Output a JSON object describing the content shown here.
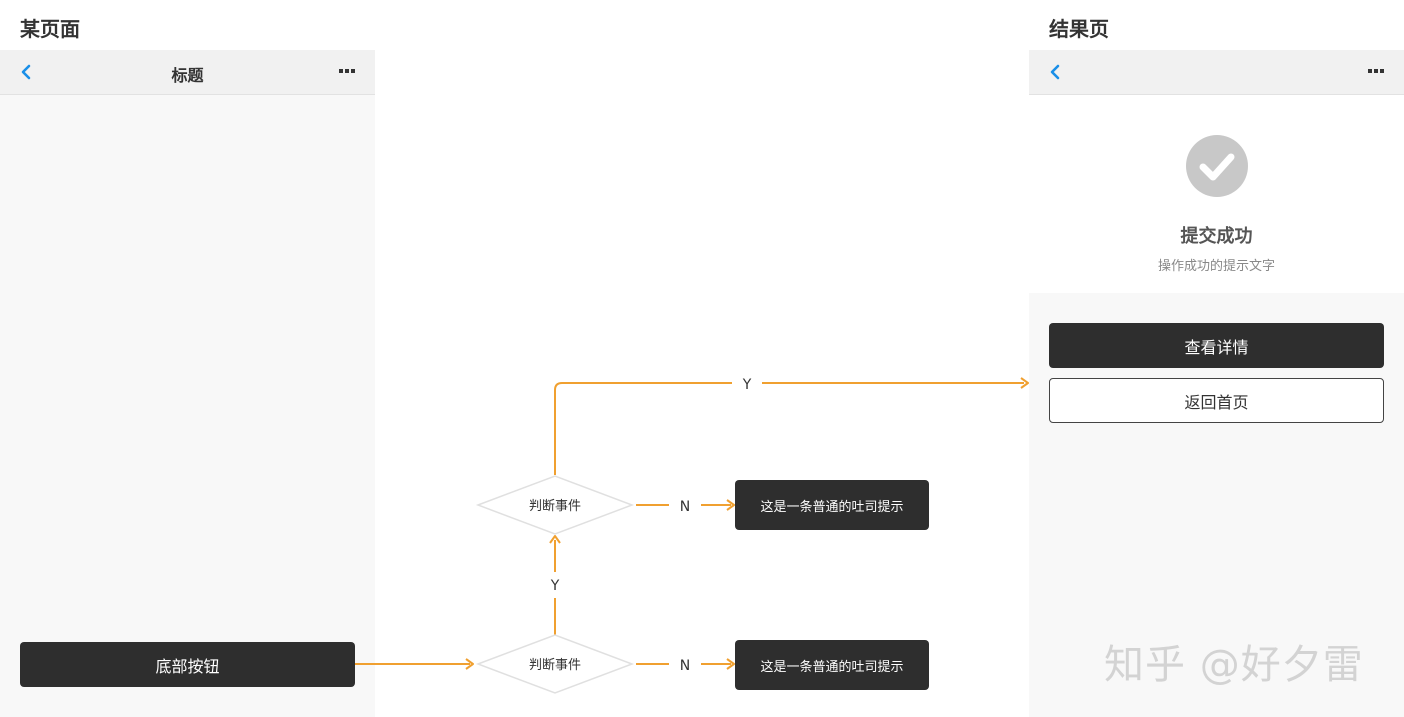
{
  "left_page": {
    "label": "某页面",
    "nav_title": "标题",
    "bottom_button": "底部按钮"
  },
  "right_page": {
    "label": "结果页",
    "result_title": "提交成功",
    "result_desc": "操作成功的提示文字",
    "primary_button": "查看详情",
    "secondary_button": "返回首页"
  },
  "flow": {
    "decision_1": "判断事件",
    "decision_2": "判断事件",
    "yes_label": "Y",
    "no_label": "N",
    "toast_1": "这是一条普通的吐司提示",
    "toast_2": "这是一条普通的吐司提示",
    "arrow_color": "#f0a030"
  },
  "icons": {
    "back": "chevron-left-icon",
    "more": "more-dots-icon",
    "success": "check-circle-icon"
  },
  "colors": {
    "accent_blue": "#1a8fe8",
    "dark_button": "#2e2e2e",
    "success_gray": "#c8c8c8"
  },
  "watermark": "知乎 @好夕雷"
}
